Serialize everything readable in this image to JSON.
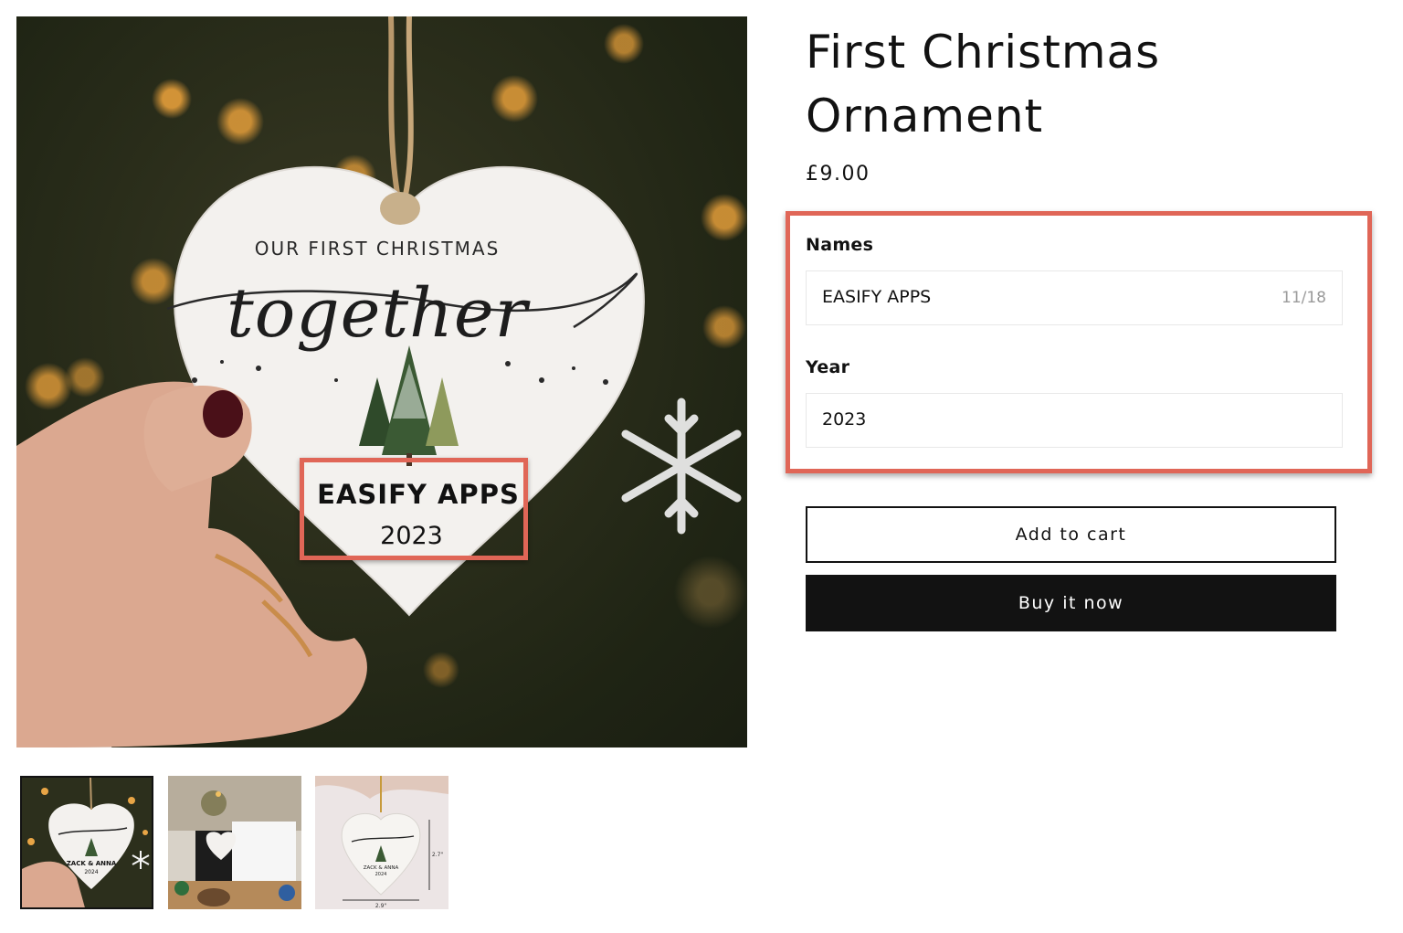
{
  "product": {
    "title": "First Christmas Ornament",
    "price": "£9.00"
  },
  "ornament_preview": {
    "heading": "OUR FIRST CHRISTMAS",
    "script_text": "together",
    "name_text": "EASIFY APPS",
    "year_text": "2023"
  },
  "options": {
    "names": {
      "label": "Names",
      "value": "EASIFY APPS",
      "counter": "11/18"
    },
    "year": {
      "label": "Year",
      "value": "2023"
    }
  },
  "buttons": {
    "add_to_cart": "Add to cart",
    "buy_now": "Buy it now"
  },
  "thumbnails": [
    {
      "name_text": "ZACK & ANNA",
      "year_text": "2024",
      "active": true
    },
    {
      "active": false
    },
    {
      "name_text": "ZACK & ANNA",
      "year_text": "2024",
      "width_label": "2.9\"",
      "height_label": "2.7\"",
      "active": false
    }
  ],
  "colors": {
    "highlight": "#e06657",
    "button_dark": "#121212",
    "text": "#121212"
  }
}
